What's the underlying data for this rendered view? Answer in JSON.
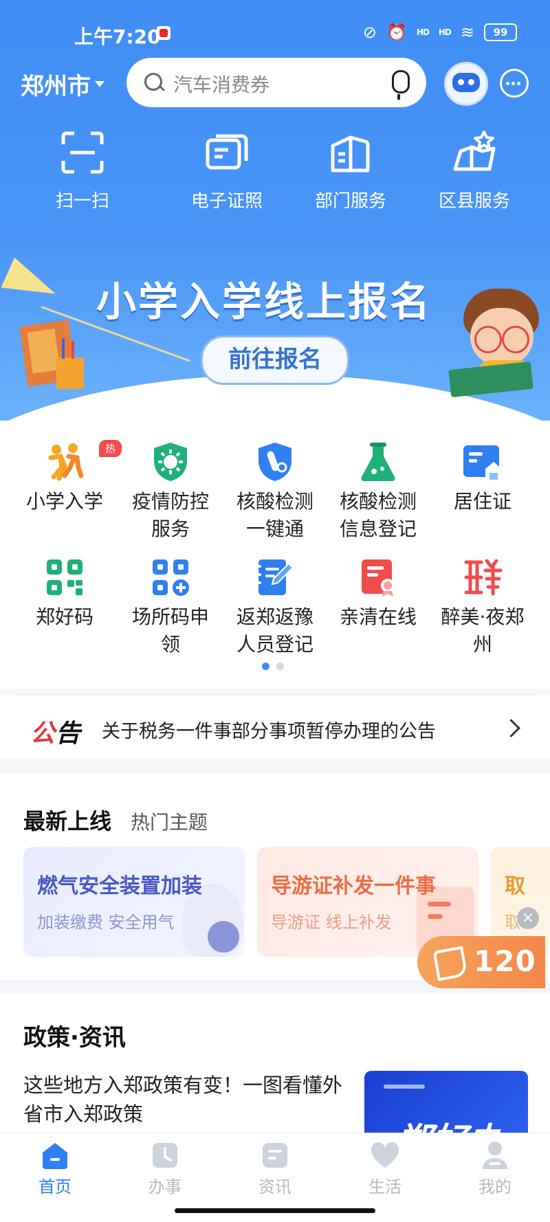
{
  "status_bar": {
    "time": "上午7:20",
    "battery": "99",
    "net1": "HD",
    "net2": "HD"
  },
  "topbar": {
    "city": "郑州市",
    "search_placeholder": "汽车消费券"
  },
  "quick_actions": [
    {
      "label": "扫一扫",
      "icon": "scan-icon"
    },
    {
      "label": "电子证照",
      "icon": "e-license-icon"
    },
    {
      "label": "部门服务",
      "icon": "department-icon"
    },
    {
      "label": "区县服务",
      "icon": "district-icon"
    }
  ],
  "banner": {
    "title": "小学入学线上报名",
    "button": "前往报名"
  },
  "services": [
    {
      "label": "小学入学",
      "icon": "school-entry-icon",
      "badge": "热"
    },
    {
      "label": "疫情防控服务",
      "icon": "epidemic-icon"
    },
    {
      "label": "核酸检测一键通",
      "icon": "nucleic-test-icon"
    },
    {
      "label": "核酸检测信息登记",
      "icon": "nucleic-register-icon"
    },
    {
      "label": "居住证",
      "icon": "residence-permit-icon"
    },
    {
      "label": "郑好码",
      "icon": "qr-code-icon"
    },
    {
      "label": "场所码申领",
      "icon": "venue-code-icon"
    },
    {
      "label": "返郑返豫人员登记",
      "icon": "return-register-icon"
    },
    {
      "label": "亲清在线",
      "icon": "qinqing-online-icon"
    },
    {
      "label": "醉美·夜郑州",
      "icon": "night-zhengzhou-icon"
    }
  ],
  "services_lines": [
    [
      "小学入学"
    ],
    [
      "疫情防控",
      "服务"
    ],
    [
      "核酸检测",
      "一键通"
    ],
    [
      "核酸检测",
      "信息登记"
    ],
    [
      "居住证"
    ],
    [
      "郑好码"
    ],
    [
      "场所码申",
      "领"
    ],
    [
      "返郑返豫",
      "人员登记"
    ],
    [
      "亲清在线"
    ],
    [
      "醉美·夜郑",
      "州"
    ]
  ],
  "pager": {
    "pages": 2,
    "current": 1
  },
  "notice": {
    "tag_a": "公",
    "tag_b": "告",
    "text": "关于税务一件事部分事项暂停办理的公告"
  },
  "latest": {
    "tab_active": "最新上线",
    "tab_other": "热门主题",
    "cards": [
      {
        "title": "燃气安全装置加装",
        "subtitle": "加装缴费 安全用气"
      },
      {
        "title": "导游证补发一件事",
        "subtitle": "导游证 线上补发"
      },
      {
        "title": "取",
        "subtitle": "取"
      }
    ]
  },
  "call_button": {
    "number": "120",
    "close": "×"
  },
  "news": {
    "section_title": "政策·资讯",
    "item_title": "这些地方入郑政策有变！一图看懂外省市入郑政策",
    "thumb_text": "郑好办"
  },
  "tabbar": [
    {
      "label": "首页",
      "icon": "home-icon",
      "active": true
    },
    {
      "label": "办事",
      "icon": "service-icon"
    },
    {
      "label": "资讯",
      "icon": "news-icon"
    },
    {
      "label": "生活",
      "icon": "life-icon"
    },
    {
      "label": "我的",
      "icon": "profile-icon"
    }
  ],
  "colors": {
    "brand": "#3f8df6",
    "accent_orange": "#f3864a",
    "hot_red": "#f24b4b"
  }
}
